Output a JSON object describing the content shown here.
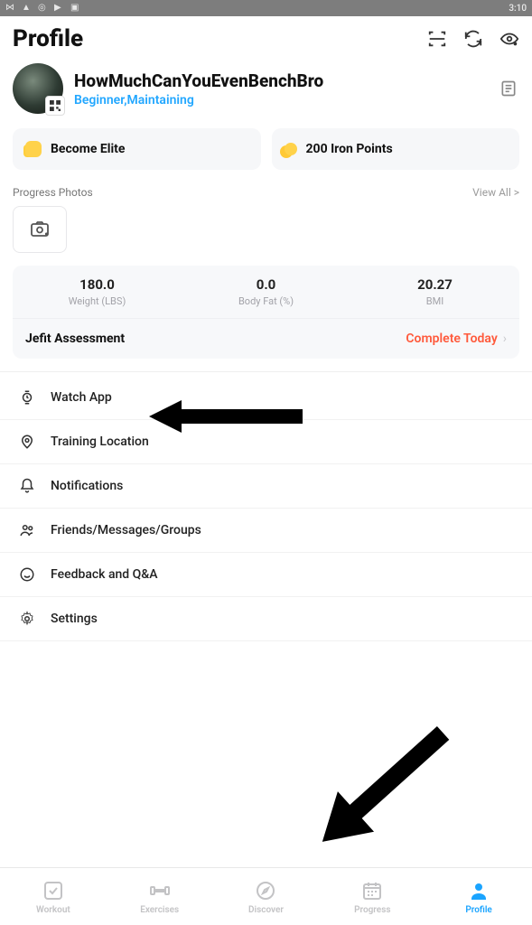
{
  "status": {
    "time": "3:10"
  },
  "header": {
    "title": "Profile"
  },
  "user": {
    "name": "HowMuchCanYouEvenBenchBro",
    "level": "Beginner,Maintaining"
  },
  "pills": {
    "elite": "Become Elite",
    "points": "200 Iron Points"
  },
  "progress": {
    "label": "Progress Photos",
    "viewall": "View All >"
  },
  "stats": {
    "weight": {
      "value": "180.0",
      "label": "Weight (LBS)"
    },
    "bodyfat": {
      "value": "0.0",
      "label": "Body Fat (%)"
    },
    "bmi": {
      "value": "20.27",
      "label": "BMI"
    }
  },
  "assessment": {
    "label": "Jefit Assessment",
    "cta": "Complete Today"
  },
  "menu": {
    "watch": "Watch App",
    "location": "Training Location",
    "notifications": "Notifications",
    "friends": "Friends/Messages/Groups",
    "feedback": "Feedback and Q&A",
    "settings": "Settings"
  },
  "tabs": {
    "workout": "Workout",
    "exercises": "Exercises",
    "discover": "Discover",
    "progress": "Progress",
    "profile": "Profile"
  }
}
